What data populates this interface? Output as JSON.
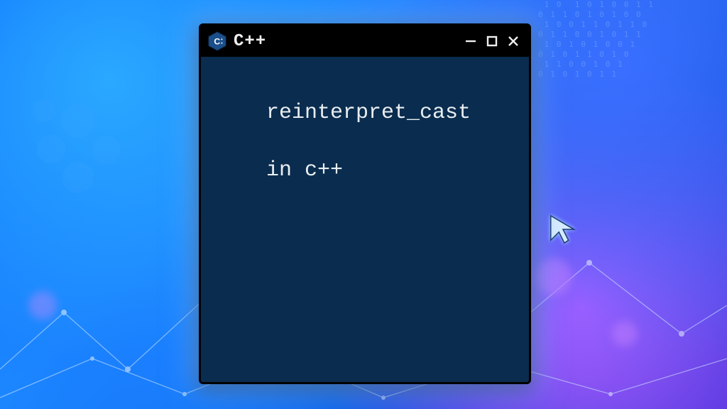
{
  "window": {
    "title": "C++",
    "icon": "cpp-logo-icon",
    "controls": {
      "minimize_name": "minimize-icon",
      "maximize_name": "maximize-icon",
      "close_name": "close-icon"
    }
  },
  "content": {
    "line1": "reinterpret_cast",
    "line2": "in c++"
  },
  "decor": {
    "bits": " 1 0  1 0 1 0 0 1 1\n0 1 1 0 1 0 1 0 0\n 1 0 0 1 1 0 1 1 0\n0 1 1 0 0 1 0 1 1\n 1 0 1 0 1 0 0 1\n0 1 0 1 1 0 1 0\n 1 1 0 0 1 0 1\n0 1 0 1 0 1 1"
  }
}
